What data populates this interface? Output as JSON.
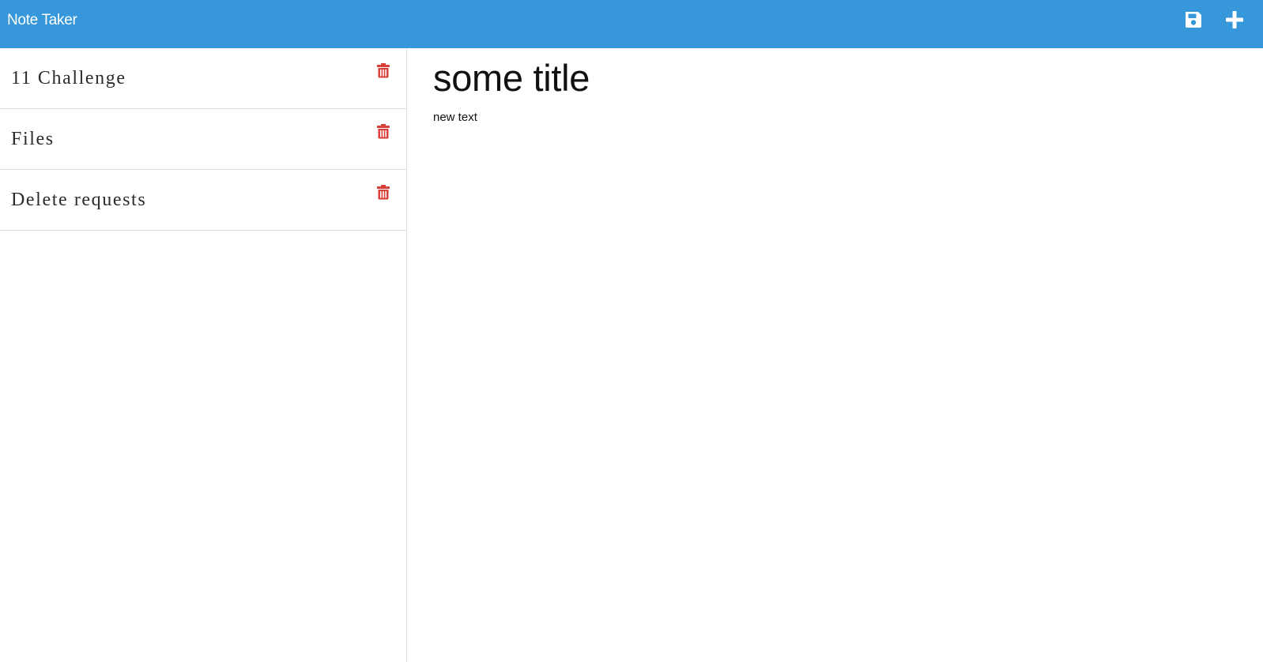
{
  "app": {
    "brand": "Note Taker",
    "accent_color": "#3698db",
    "delete_color": "#d9403a"
  },
  "toolbar": {
    "save_icon": "floppy-disk-icon",
    "new_icon": "plus-icon"
  },
  "notes": [
    {
      "title": "11 Challenge",
      "delete_icon": "trash-icon"
    },
    {
      "title": "Files",
      "delete_icon": "trash-icon"
    },
    {
      "title": "Delete requests",
      "delete_icon": "trash-icon"
    }
  ],
  "editor": {
    "title": "some title",
    "text": "new text"
  }
}
